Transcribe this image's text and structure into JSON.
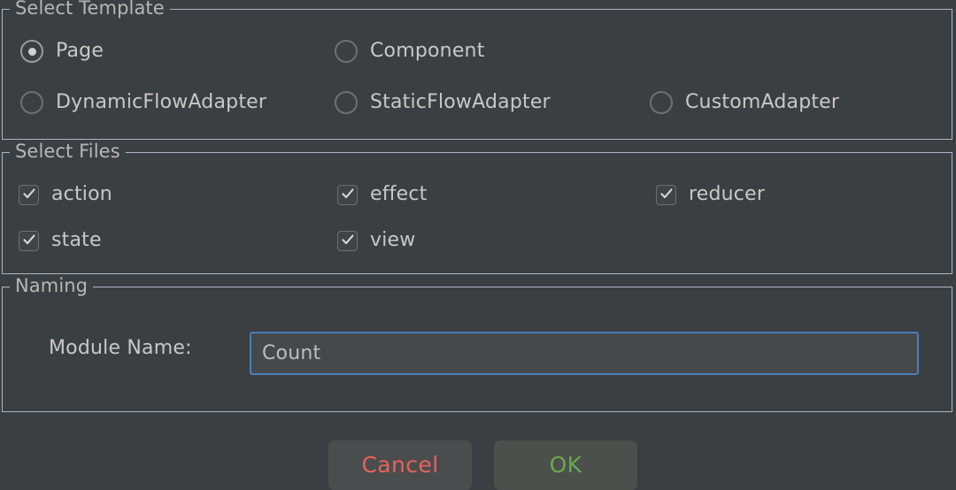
{
  "dialog": {
    "groups": [
      {
        "id": "select-template",
        "title": "Select Template",
        "options": [
          {
            "label": "Page",
            "checked": true
          },
          {
            "label": "Component",
            "checked": false
          },
          {
            "label": "DynamicFlowAdapter",
            "checked": false
          },
          {
            "label": "StaticFlowAdapter",
            "checked": false
          },
          {
            "label": "CustomAdapter",
            "checked": false
          }
        ]
      },
      {
        "id": "select-files",
        "title": "Select Files",
        "options": [
          {
            "label": "action",
            "checked": true
          },
          {
            "label": "effect",
            "checked": true
          },
          {
            "label": "reducer",
            "checked": true
          },
          {
            "label": "state",
            "checked": true
          },
          {
            "label": "view",
            "checked": true
          }
        ]
      },
      {
        "id": "naming",
        "title": "Naming",
        "module_name_label": "Module Name:",
        "module_name_value": "Count",
        "module_name_placeholder": "Module Name"
      }
    ],
    "buttons": {
      "cancel_label": "Cancel",
      "ok_label": "OK"
    },
    "icons": {
      "radio_selected": "radio-selected-icon",
      "radio_unselected": "radio-unselected-icon",
      "checkbox_checked": "checkbox-checked-icon"
    },
    "colors": {
      "background": "#3c3f41",
      "group_border": "#a9b7c6",
      "text": "#c8c8c8",
      "input_focus_border": "#4a7ebb",
      "cancel_text": "#e8625c",
      "ok_text": "#6aa84f"
    }
  }
}
